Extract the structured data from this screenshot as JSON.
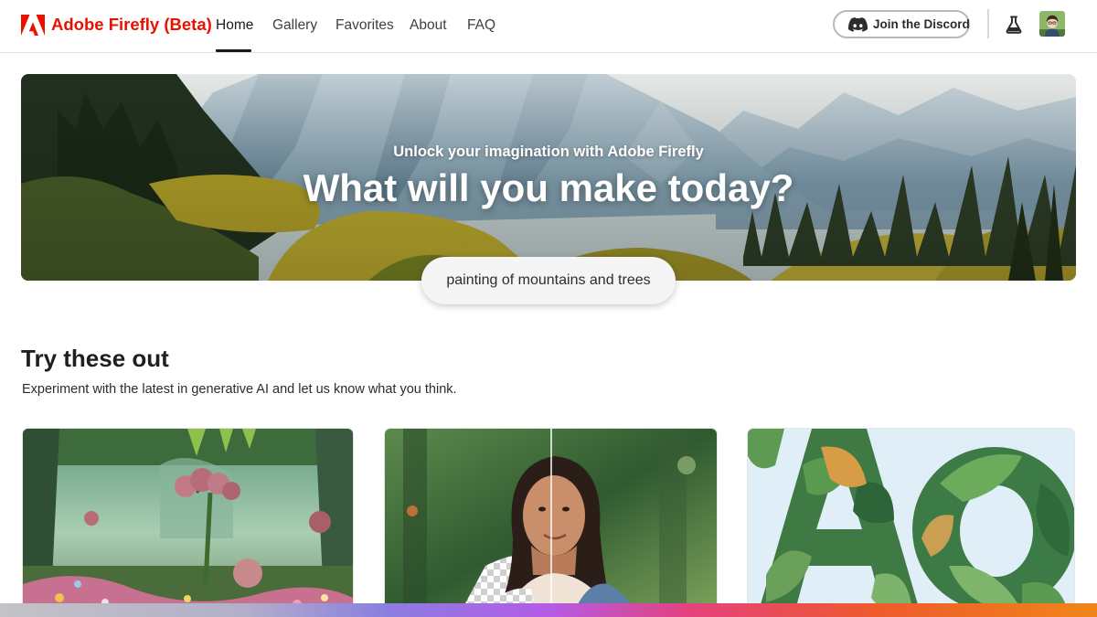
{
  "brand": {
    "name": "Adobe Firefly (Beta)",
    "logo_icon": "adobe-logo-icon",
    "color": "#eb1000"
  },
  "nav": {
    "tabs": [
      {
        "label": "Home",
        "active": true
      },
      {
        "label": "Gallery",
        "active": false
      },
      {
        "label": "Favorites",
        "active": false
      },
      {
        "label": "About",
        "active": false
      },
      {
        "label": "FAQ",
        "active": false
      }
    ]
  },
  "actions": {
    "discord_label": "Join the Discord",
    "discord_icon": "discord-icon",
    "labs_icon": "flask-icon",
    "avatar_icon": "user-avatar"
  },
  "hero": {
    "subtitle": "Unlock your imagination with Adobe Firefly",
    "title": "What will you make today?",
    "prompt": "painting of mountains and trees"
  },
  "section": {
    "title": "Try these out",
    "description": "Experiment with the latest in generative AI and let us know what you think."
  },
  "cards": [
    {
      "name": "fantasy-garden-image"
    },
    {
      "name": "portrait-background-removal-image"
    },
    {
      "name": "leaf-letters-image"
    }
  ],
  "colors": {
    "accent": "#eb1000",
    "text": "#2c2c2c",
    "pill_bg": "#f5f5f5"
  }
}
